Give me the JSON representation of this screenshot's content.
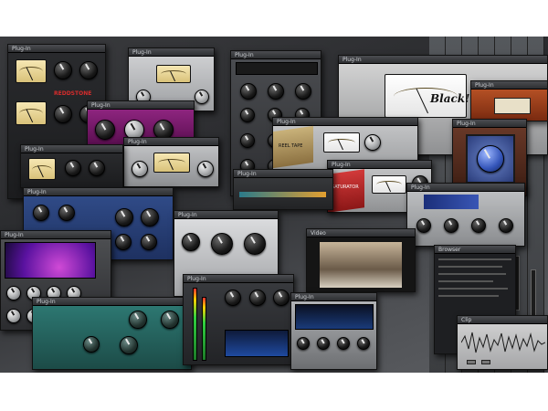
{
  "image": {
    "description_alt": "Collage of audio plug-in windows over a DAW mixer"
  },
  "plugins": [
    {
      "id": "la2a-a",
      "title": "Plug-In",
      "brand": "REDDSTONE"
    },
    {
      "id": "pultec",
      "title": "Plug-In"
    },
    {
      "id": "fairchild",
      "title": "Plug-In"
    },
    {
      "id": "channel-strip-gray",
      "title": "Plug-In"
    },
    {
      "id": "tape-machine",
      "title": "Plug-In",
      "brand": "Black!"
    },
    {
      "id": "purple-comp",
      "title": "Plug-In"
    },
    {
      "id": "reel-tape-1",
      "title": "Plug-In",
      "tag": "REEL TAPE"
    },
    {
      "id": "reel-tape-2",
      "title": "Plug-In",
      "tag": "SATURATOR"
    },
    {
      "id": "blue-knob",
      "title": "Plug-In"
    },
    {
      "id": "vocal-rider",
      "title": "Plug-In"
    },
    {
      "id": "blue-strip",
      "title": "Plug-In"
    },
    {
      "id": "silver-pre",
      "title": "Plug-In"
    },
    {
      "id": "purple-verb",
      "title": "Plug-In"
    },
    {
      "id": "meter-rack",
      "title": "Plug-In"
    },
    {
      "id": "video-window",
      "title": "Video"
    },
    {
      "id": "file-browser",
      "title": "Browser"
    },
    {
      "id": "teal-delay",
      "title": "Plug-In"
    },
    {
      "id": "spectrum",
      "title": "Plug-In"
    },
    {
      "id": "waveform",
      "title": "Clip"
    }
  ],
  "colors": {
    "daw_bg": "#2e2f32",
    "vu_face": "#f0dca0",
    "purple_panel": "#7b1a6d",
    "blue_panel": "#2f4a86",
    "teal_panel": "#2e6f6b",
    "orange_accent": "#e39a2b",
    "red_panel": "#b22b2b"
  }
}
